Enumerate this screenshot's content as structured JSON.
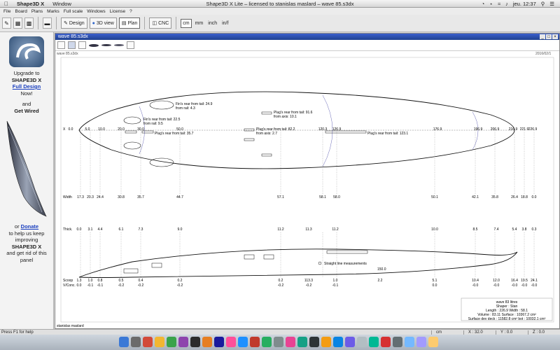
{
  "menubar": {
    "app_name": "Shape3D X",
    "menu": "Window",
    "window_title": "Shape3D X Lite – licensed to stanislas maslard – wave 85.s3dx",
    "clock": "jeu. 12:37"
  },
  "app_menu": [
    "File",
    "Board",
    "Plans",
    "Marks",
    "Full scale",
    "Windows",
    "License",
    "?"
  ],
  "toolbar": {
    "design_label": "Design",
    "view3d_label": "3D view",
    "plan_label": "Plan",
    "cnc_label": "CNC",
    "units": [
      "cm",
      "mm",
      "inch",
      "in/f"
    ]
  },
  "left_panel": {
    "line1": "Upgrade to",
    "line2": "SHAPE3D X",
    "link1": "Full Design",
    "line3": "Now!",
    "line4": "and",
    "line5": "Get Wired",
    "line6": "or",
    "link2": "Donate",
    "line7": "to help us keep improving",
    "line8": "SHAPE3D X",
    "line9": "and get rid of this panel"
  },
  "document": {
    "tab_title": "wave 85.s3dx",
    "file_label": "wave 85.s3dx",
    "date": "2016/02/1",
    "author": "stanislas maslard"
  },
  "plan": {
    "x_label": "X",
    "x_values": [
      "0.0",
      "5.0",
      "10.0",
      "20.0",
      "30.0",
      "50.0",
      "120.3",
      "126.9",
      "176.9",
      "196.9",
      "206.9",
      "216.9",
      "221.9",
      "226.9"
    ],
    "width_label": "Width",
    "width_values": [
      "17.3",
      "20.3",
      "24.4",
      "30.8",
      "35.7",
      "44.7",
      "57.1",
      "58.1",
      "58.0",
      "50.1",
      "42.1",
      "35.8",
      "26.4",
      "18.8",
      "0.0"
    ],
    "fin_notes": [
      "Fin's rear from tail: 24.9\nfrom rail: 4.3",
      "Fin's rear from tail: 22.5\nfrom rail: 9.5"
    ],
    "plug_notes": [
      "Plug's rear from tail: 91.6\nfrom axis: 10.1",
      "Plug's rear from tail: 82.2\nfrom axis: 2.7",
      "Plug's rear from tail: 35.7",
      "Plug's rear from tail: 123.1"
    ],
    "thick_label": "Thick.",
    "thick_values": [
      "0.0",
      "3.1",
      "4.4",
      "6.1",
      "7.3",
      "9.0",
      "11.2",
      "11.3",
      "11.2",
      "10.0",
      "8.5",
      "7.4",
      "5.4",
      "3.8",
      "0.3"
    ],
    "straight_line_label": "Straight line measurements",
    "rocker_mid_value": "150.0",
    "scoop_label": "Scoop",
    "scoop_values": [
      "1.3",
      "1.0",
      "0.8",
      "0.5",
      "0.4",
      "0.2",
      "0.2",
      "113.3",
      "1.0",
      "2.2",
      "5.1",
      "10.4",
      "12.0",
      "16.4",
      "19.5",
      "24.1"
    ],
    "vconc_label": "V/Conc.",
    "vconc_values": [
      "0.0",
      "-0.1",
      "-0.1",
      "-0.2",
      "-0.2",
      "-0.2",
      "-0.2",
      "-0.2",
      "-0.1",
      "0.0",
      "-0.0",
      "-0.0",
      "-0.0",
      "-0.0",
      "-0.0"
    ]
  },
  "info_box": {
    "line1": "wave 83 litres",
    "line2": "Shaper : Stan",
    "line3": "Length : 226.9 Width : 58.1",
    "line4": "Volume : 83.11 Surface : 10367.2 cm²",
    "line5": "Surface dev deck : 11582.8 cm² bot : 10032.1 cm²"
  },
  "status": {
    "help": "Press F1 for help",
    "unit": "cm",
    "x": "X : 32.0",
    "y": "Y : 0.0",
    "z": "Z : 0.0"
  },
  "dock_colors": [
    "#3b79d6",
    "#6b6b6b",
    "#d24a3a",
    "#f2b632",
    "#3aa34a",
    "#8e44ad",
    "#2c2c2c",
    "#e67e22",
    "#1a1a9c",
    "#ff4f9a",
    "#1e90ff",
    "#c0392b",
    "#27ae60",
    "#7f8c8d",
    "#e84393",
    "#16a085",
    "#2d3436",
    "#f39c12",
    "#0984e3",
    "#6c5ce7",
    "#b2bec3",
    "#00b894",
    "#d63031",
    "#636e72",
    "#74b9ff",
    "#a29bfe",
    "#fdcb6e"
  ]
}
